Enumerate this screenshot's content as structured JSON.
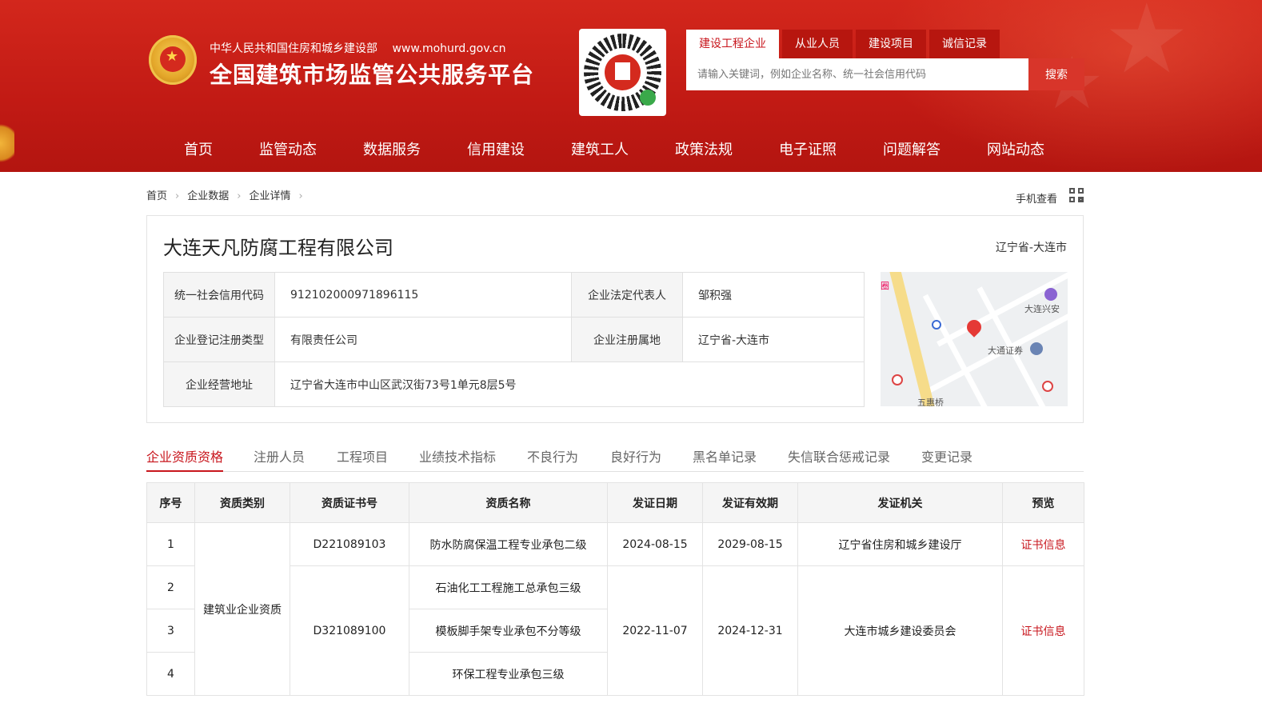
{
  "header": {
    "ministry": "中华人民共和国住房和城乡建设部",
    "url": "www.mohurd.gov.cn",
    "title": "全国建筑市场监管公共服务平台",
    "qr_icon": "qrcode-icon"
  },
  "search": {
    "tabs": [
      {
        "label": "建设工程企业",
        "active": true
      },
      {
        "label": "从业人员",
        "active": false
      },
      {
        "label": "建设项目",
        "active": false
      },
      {
        "label": "诚信记录",
        "active": false
      }
    ],
    "placeholder": "请输入关键词，例如企业名称、统一社会信用代码",
    "button": "搜索"
  },
  "nav": [
    "首页",
    "监管动态",
    "数据服务",
    "信用建设",
    "建筑工人",
    "政策法规",
    "电子证照",
    "问题解答",
    "网站动态"
  ],
  "breadcrumb": [
    "首页",
    "企业数据",
    "企业详情"
  ],
  "mobile_view": "手机查看",
  "company": {
    "name": "大连天凡防腐工程有限公司",
    "region": "辽宁省-大连市",
    "fields": {
      "credit_code_label": "统一社会信用代码",
      "credit_code": "912102000971896115",
      "legal_rep_label": "企业法定代表人",
      "legal_rep": "邹积强",
      "reg_type_label": "企业登记注册类型",
      "reg_type": "有限责任公司",
      "reg_place_label": "企业注册属地",
      "reg_place": "辽宁省-大连市",
      "address_label": "企业经营地址",
      "address": "辽宁省大连市中山区武汉街73号1单元8层5号"
    },
    "map_labels": [
      "大连兴安",
      "大通证券",
      "五惠桥",
      "圈"
    ]
  },
  "tabs": [
    {
      "label": "企业资质资格",
      "active": true
    },
    {
      "label": "注册人员",
      "active": false
    },
    {
      "label": "工程项目",
      "active": false
    },
    {
      "label": "业绩技术指标",
      "active": false
    },
    {
      "label": "不良行为",
      "active": false
    },
    {
      "label": "良好行为",
      "active": false
    },
    {
      "label": "黑名单记录",
      "active": false
    },
    {
      "label": "失信联合惩戒记录",
      "active": false
    },
    {
      "label": "变更记录",
      "active": false
    }
  ],
  "qualifications": {
    "headers": [
      "序号",
      "资质类别",
      "资质证书号",
      "资质名称",
      "发证日期",
      "发证有效期",
      "发证机关",
      "预览"
    ],
    "category": "建筑业企业资质",
    "rows": [
      {
        "no": "1",
        "cert": "D221089103",
        "name": "防水防腐保温工程专业承包二级",
        "issue": "2024-08-15",
        "valid": "2029-08-15",
        "authority": "辽宁省住房和城乡建设厅",
        "preview": "证书信息"
      },
      {
        "no": "2",
        "cert": "D321089100",
        "name": "石油化工工程施工总承包三级",
        "issue": "2022-11-07",
        "valid": "2024-12-31",
        "authority": "大连市城乡建设委员会",
        "preview": "证书信息"
      },
      {
        "no": "3",
        "name": "模板脚手架专业承包不分等级"
      },
      {
        "no": "4",
        "name": "环保工程专业承包三级"
      }
    ]
  }
}
